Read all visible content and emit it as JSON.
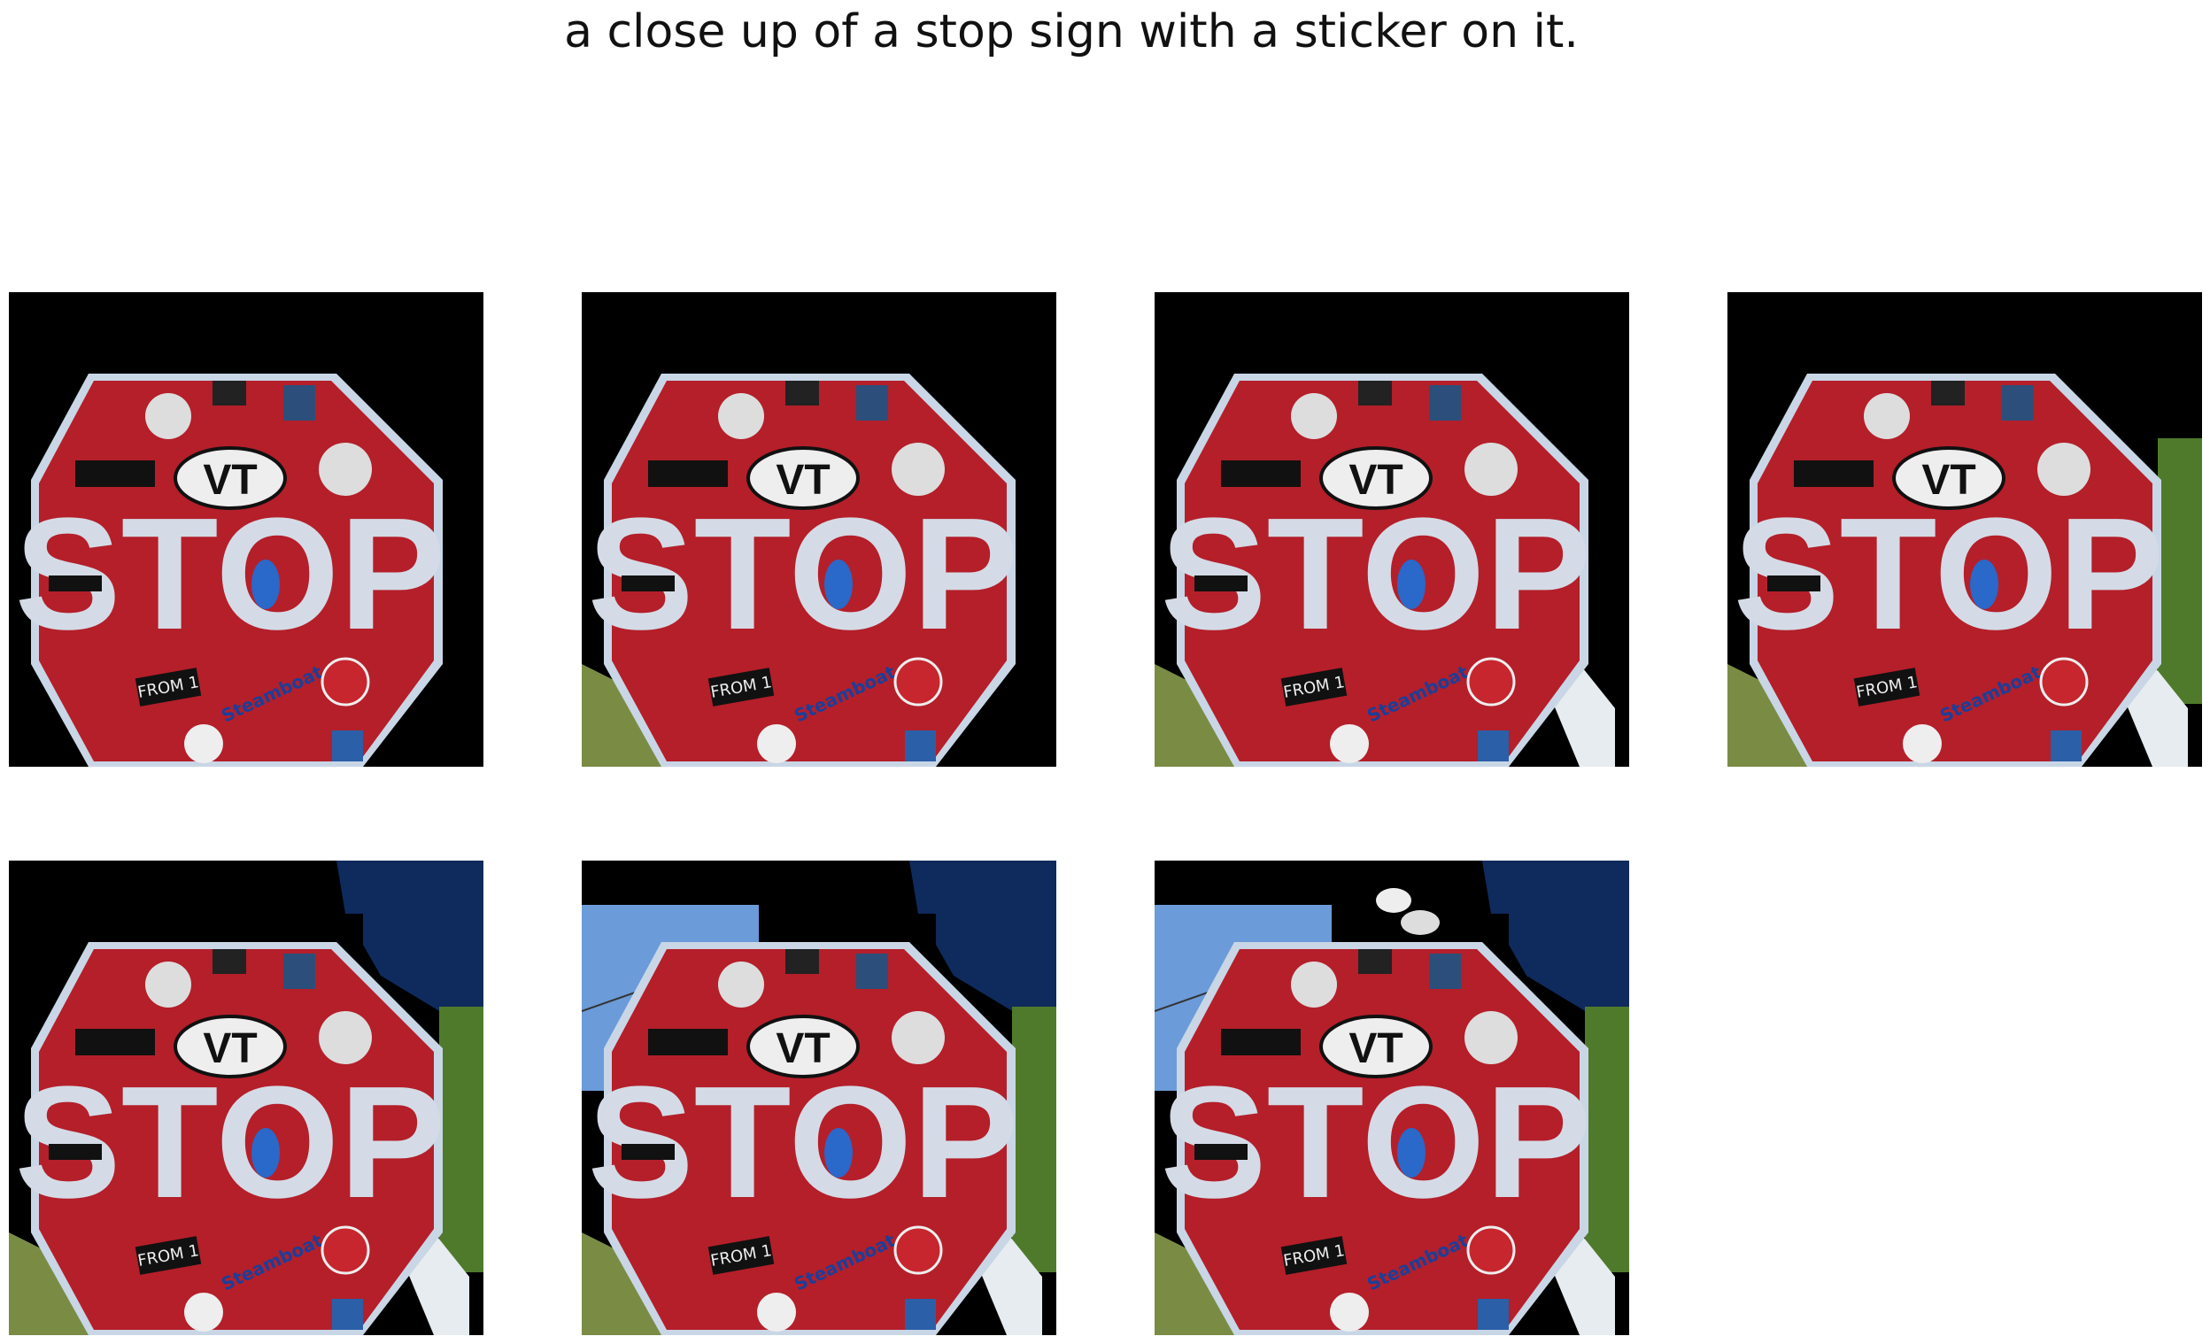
{
  "caption": "a close up of a stop sign with a sticker on it.",
  "sign": {
    "word": "STOP",
    "oval": "VT",
    "sticker_from": "FROM 1",
    "sticker_steamboat": "Steamboat",
    "colors": {
      "red": "#b41f2a",
      "border": "#c9d6e6",
      "letters": "#d4dbe6"
    }
  },
  "panels": [
    {
      "id": "p1",
      "grass": false,
      "post": false,
      "hedge": false,
      "sky": false,
      "tree": false,
      "bird": false
    },
    {
      "id": "p2",
      "grass": true,
      "post": false,
      "hedge": false,
      "sky": false,
      "tree": false,
      "bird": false
    },
    {
      "id": "p3",
      "grass": true,
      "post": true,
      "hedge": false,
      "sky": false,
      "tree": false,
      "bird": false
    },
    {
      "id": "p4",
      "grass": true,
      "post": true,
      "hedge": true,
      "sky": false,
      "tree": false,
      "bird": false
    },
    {
      "id": "p5",
      "grass": true,
      "post": true,
      "hedge": true,
      "sky": false,
      "tree": true,
      "bird": false
    },
    {
      "id": "p6",
      "grass": true,
      "post": true,
      "hedge": true,
      "sky": true,
      "tree": true,
      "bird": false
    },
    {
      "id": "p7",
      "grass": true,
      "post": true,
      "hedge": true,
      "sky": true,
      "tree": true,
      "bird": true
    }
  ]
}
